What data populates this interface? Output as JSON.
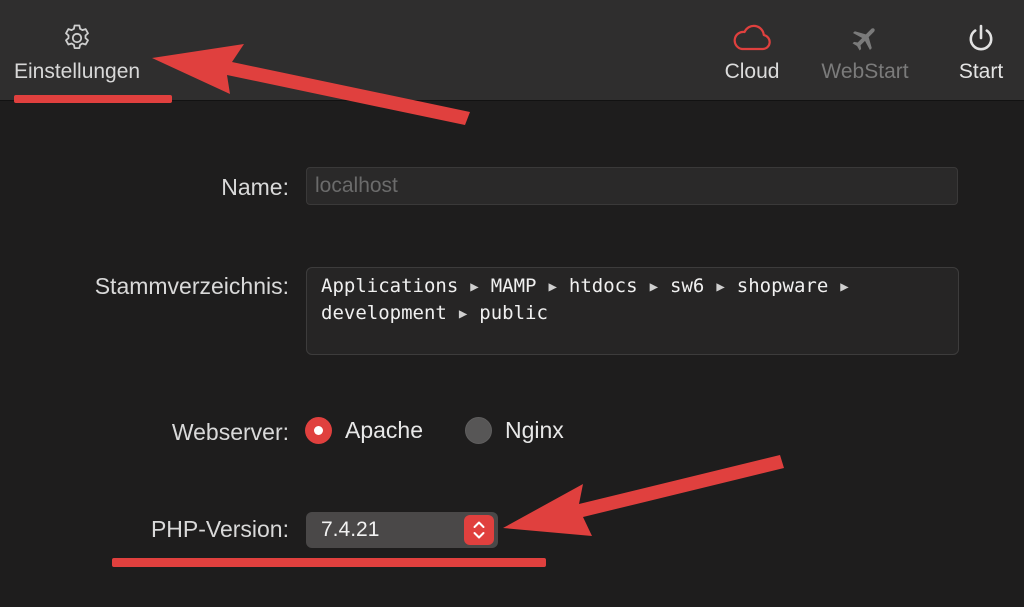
{
  "toolbar": {
    "settings_label": "Einstellungen",
    "cloud_label": "Cloud",
    "webstart_label": "WebStart",
    "start_label": "Start"
  },
  "form": {
    "name_label": "Name:",
    "name_placeholder": "localhost",
    "root_label": "Stammverzeichnis:",
    "root_path": [
      "Applications",
      "MAMP",
      "htdocs",
      "sw6",
      "shopware",
      "development",
      "public"
    ],
    "path_separator": "▶",
    "webserver_label": "Webserver:",
    "webserver_options": [
      {
        "label": "Apache",
        "selected": true
      },
      {
        "label": "Nginx",
        "selected": false
      }
    ],
    "php_label": "PHP-Version:",
    "php_value": "7.4.21"
  },
  "colors": {
    "accent": "#e0403e",
    "annotation": "#e0403e",
    "toolbar_bg": "#2f2e2e",
    "window_bg": "#1e1d1d"
  },
  "icons": {
    "settings": "gear-icon",
    "cloud": "cloud-icon",
    "webstart": "airplane-icon",
    "start": "power-icon",
    "stepper": "chevron-up-down-icon"
  }
}
